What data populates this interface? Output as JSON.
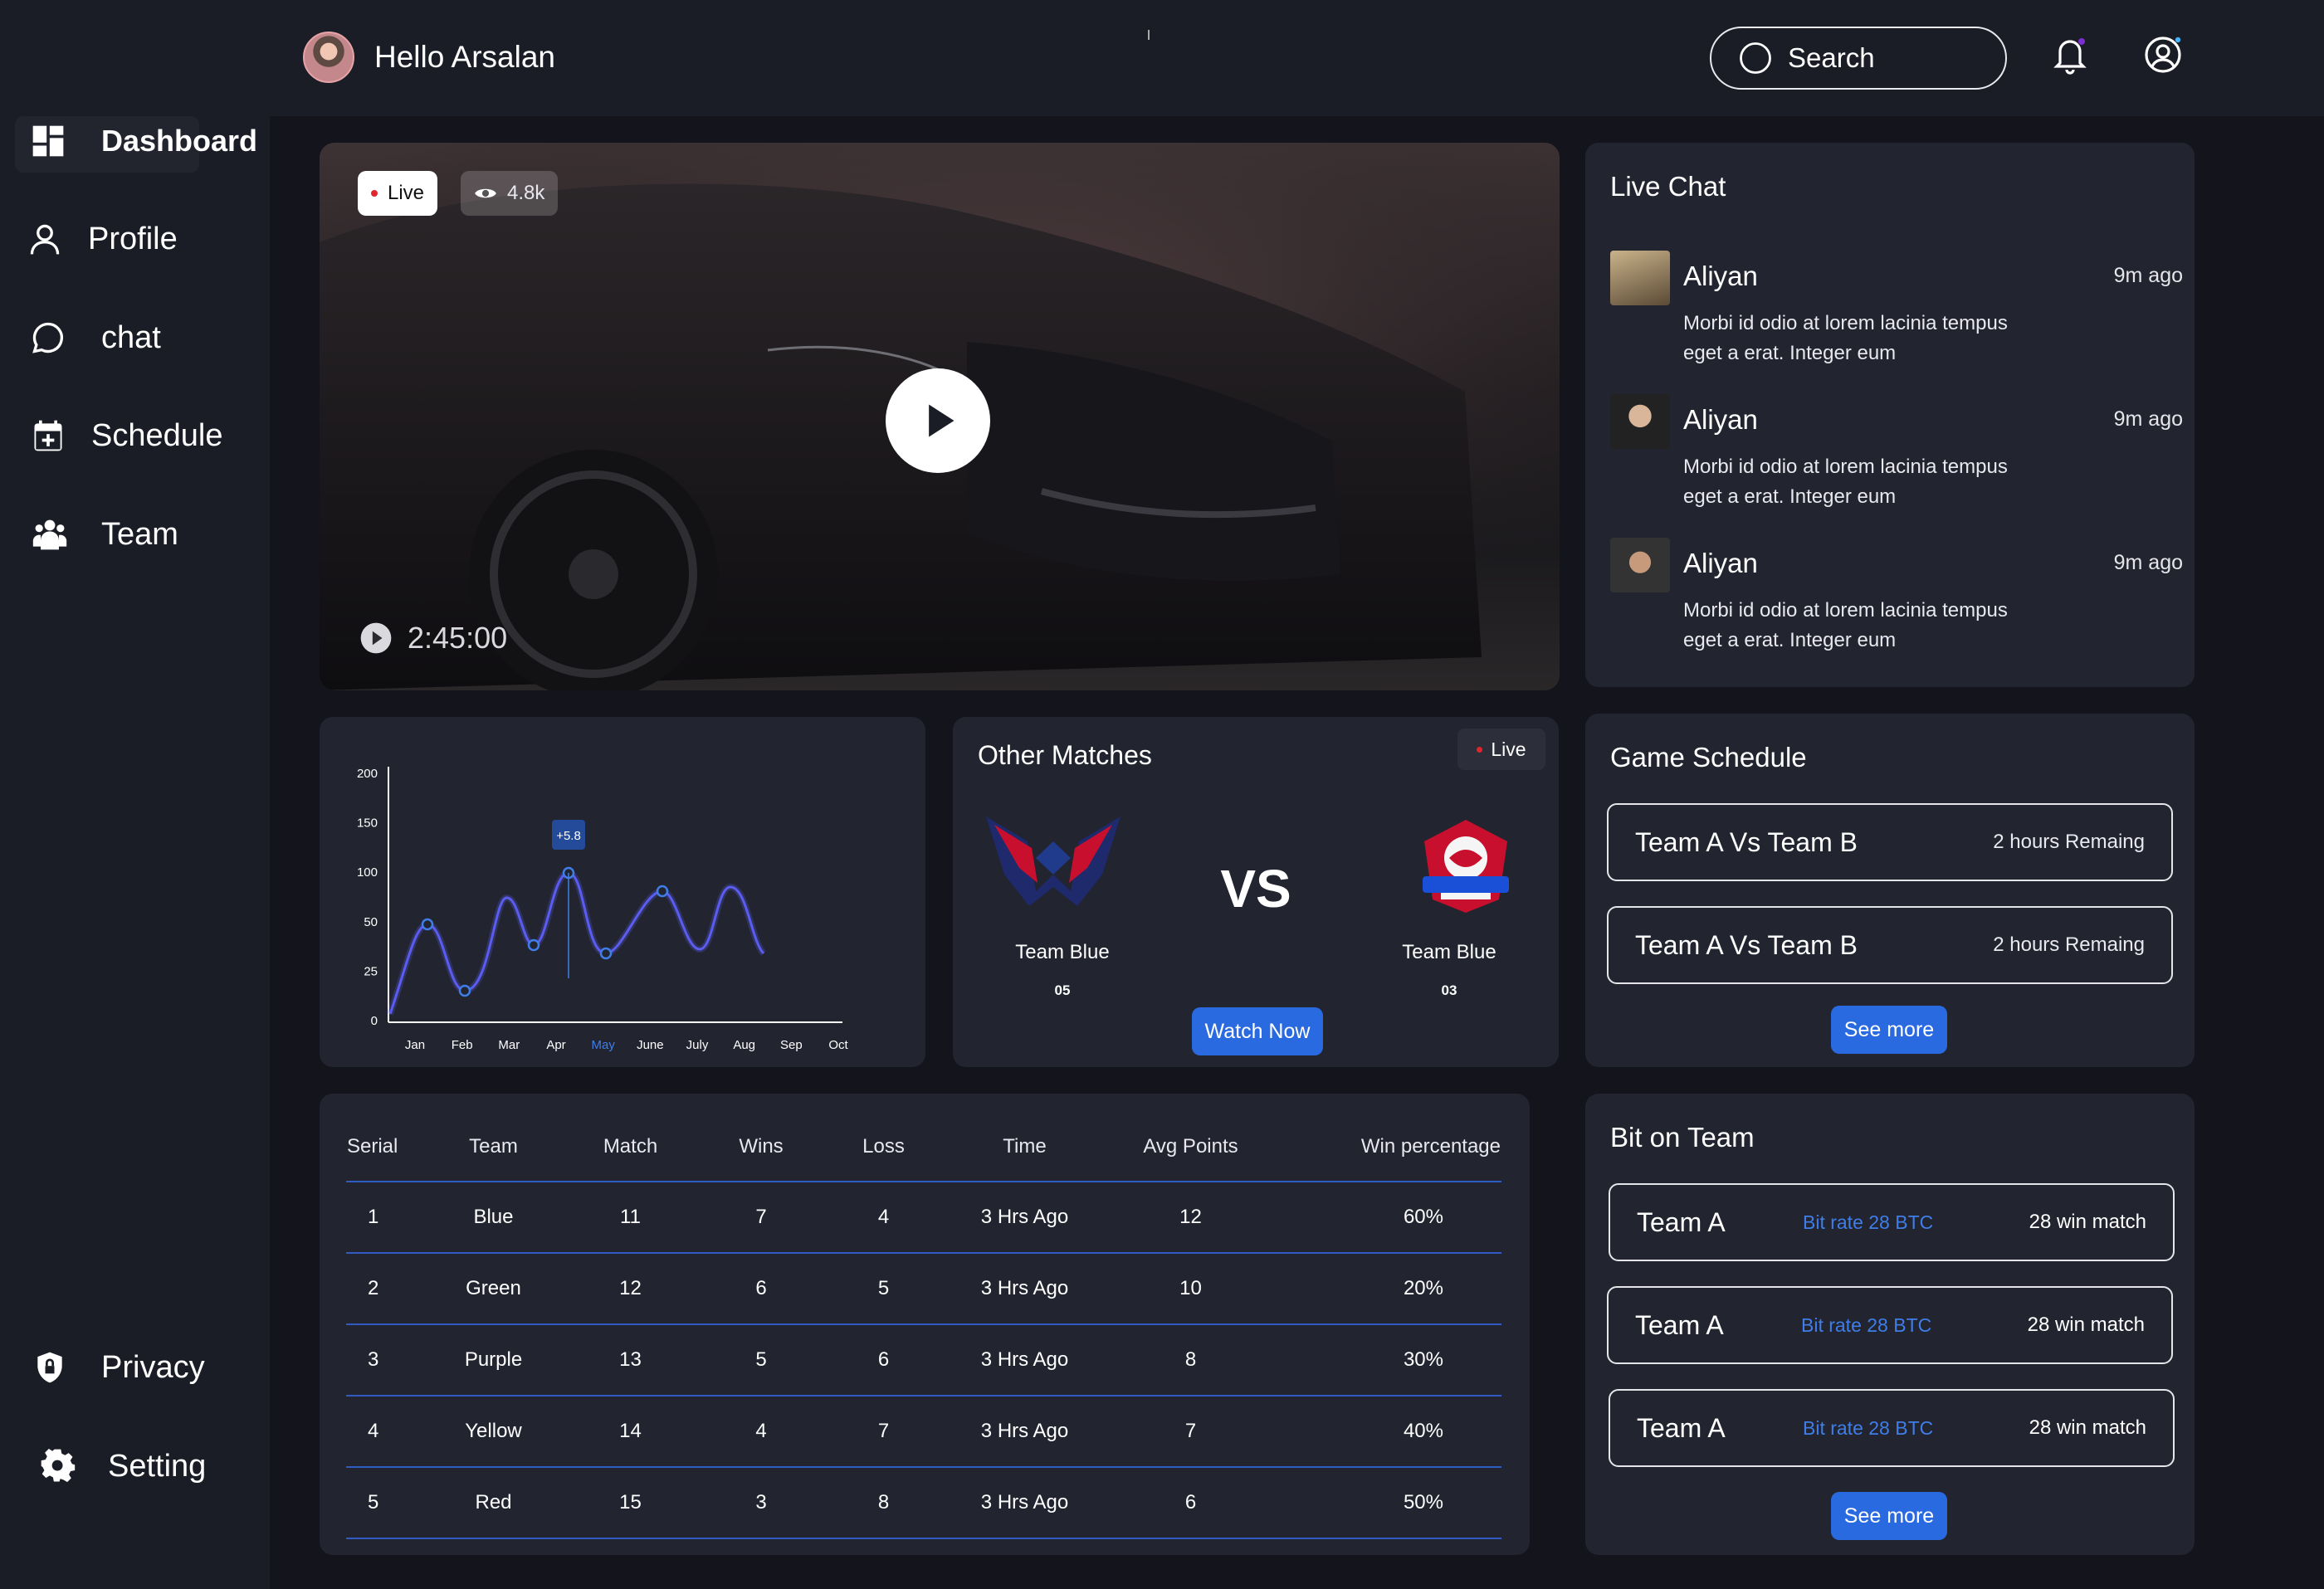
{
  "header": {
    "greeting": "Hello Arsalan",
    "search_placeholder": "Search"
  },
  "sidebar": {
    "items": [
      {
        "label": "Dashboard",
        "icon": "dashboard-icon"
      },
      {
        "label": "Profile",
        "icon": "user-icon"
      },
      {
        "label": "chat",
        "icon": "chat-icon"
      },
      {
        "label": "Schedule",
        "icon": "calendar-icon"
      },
      {
        "label": "Team",
        "icon": "team-icon"
      }
    ],
    "bottom": [
      {
        "label": "Privacy",
        "icon": "shield-icon"
      },
      {
        "label": "Setting",
        "icon": "gear-icon"
      }
    ]
  },
  "video": {
    "live_label": "Live",
    "views": "4.8k",
    "duration": "2:45:00"
  },
  "live_chat": {
    "title": "Live Chat",
    "messages": [
      {
        "name": "Aliyan",
        "time": "9m ago",
        "text": "Morbi id odio at lorem lacinia tempus eget a erat. Integer eum"
      },
      {
        "name": "Aliyan",
        "time": "9m ago",
        "text": "Morbi id odio at lorem lacinia tempus eget a erat. Integer eum"
      },
      {
        "name": "Aliyan",
        "time": "9m ago",
        "text": "Morbi id odio at lorem lacinia tempus eget a erat. Integer eum"
      }
    ]
  },
  "chart_data": {
    "type": "line",
    "categories": [
      "Jan",
      "Feb",
      "Mar",
      "Apr",
      "May",
      "June",
      "July",
      "Aug",
      "Sep",
      "Oct"
    ],
    "y_ticks": [
      "200",
      "150",
      "100",
      "50",
      "25",
      "0"
    ],
    "highlight_label": "+5.8",
    "highlight_category": "May",
    "accent": "#5b5cf0",
    "grid": false,
    "legend": "none"
  },
  "other_matches": {
    "title": "Other Matches",
    "live_label": "Live",
    "vs": "VS",
    "team_left": {
      "name": "Team Blue",
      "score": "05"
    },
    "team_right": {
      "name": "Team Blue",
      "score": "03"
    },
    "watch_label": "Watch Now"
  },
  "game_schedule": {
    "title": "Game Schedule",
    "rows": [
      {
        "match": "Team A  Vs  Team B",
        "remaining": "2 hours Remaing"
      },
      {
        "match": "Team A  Vs  Team B",
        "remaining": "2 hours Remaing"
      }
    ],
    "see_more": "See more"
  },
  "table": {
    "headers": [
      "Serial",
      "Team",
      "Match",
      "Wins",
      "Loss",
      "Time",
      "Avg Points",
      "Win percentage"
    ],
    "rows": [
      [
        "1",
        "Blue",
        "11",
        "7",
        "4",
        "3 Hrs Ago",
        "12",
        "60%"
      ],
      [
        "2",
        "Green",
        "12",
        "6",
        "5",
        "3 Hrs Ago",
        "10",
        "20%"
      ],
      [
        "3",
        "Purple",
        "13",
        "5",
        "6",
        "3 Hrs Ago",
        "8",
        "30%"
      ],
      [
        "4",
        "Yellow",
        "14",
        "4",
        "7",
        "3 Hrs Ago",
        "7",
        "40%"
      ],
      [
        "5",
        "Red",
        "15",
        "3",
        "8",
        "3 Hrs Ago",
        "6",
        "50%"
      ]
    ]
  },
  "bit_on_team": {
    "title": "Bit on Team",
    "rows": [
      {
        "team": "Team A",
        "rate": "Bit rate 28 BTC",
        "wins": "28 win match"
      },
      {
        "team": "Team A",
        "rate": "Bit rate 28 BTC",
        "wins": "28 win match"
      },
      {
        "team": "Team A",
        "rate": "Bit rate 28 BTC",
        "wins": "28 win match"
      }
    ],
    "see_more": "See more"
  },
  "colors": {
    "accent_blue": "#2a6ae0",
    "live_red": "#e0262c",
    "bit_rate": "#3f7ee8"
  }
}
